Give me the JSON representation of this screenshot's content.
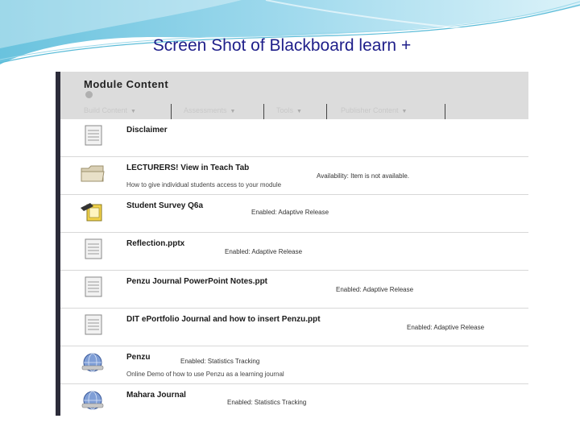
{
  "slide": {
    "title": "Screen Shot of Blackboard learn +"
  },
  "module": {
    "title": "Module  Content"
  },
  "toolbar": {
    "items": [
      {
        "label": "Build Content"
      },
      {
        "label": "Assessments"
      },
      {
        "label": "Tools"
      },
      {
        "label": "Publisher Content"
      }
    ]
  },
  "items": [
    {
      "title": "Disclaimer",
      "status": "",
      "description": "",
      "icon": "document-icon"
    },
    {
      "title": "LECTURERS! View in Teach Tab",
      "status": "Availability: Item is not available.",
      "description": "How to give individual students access to your module",
      "icon": "folder-icon"
    },
    {
      "title": "Student Survey Q6a",
      "status": "Enabled:  Adaptive Release",
      "description": "",
      "icon": "survey-icon"
    },
    {
      "title": "Reflection.pptx",
      "status": "Enabled:  Adaptive Release",
      "description": "",
      "icon": "document-icon"
    },
    {
      "title": "Penzu Journal PowerPoint Notes.ppt",
      "status": "Enabled:  Adaptive Release",
      "description": "",
      "icon": "document-icon"
    },
    {
      "title": "DIT ePortfolio Journal and how to insert Penzu.ppt",
      "status": "Enabled:  Adaptive Release",
      "description": "",
      "icon": "document-icon"
    },
    {
      "title": "Penzu",
      "status": "Enabled:  Statistics Tracking",
      "description": "Online Demo of how to use Penzu as a learning journal",
      "icon": "web-link-icon"
    },
    {
      "title": "Mahara Journal",
      "status": "Enabled:  Statistics Tracking",
      "description": "",
      "icon": "web-link-icon"
    }
  ]
}
